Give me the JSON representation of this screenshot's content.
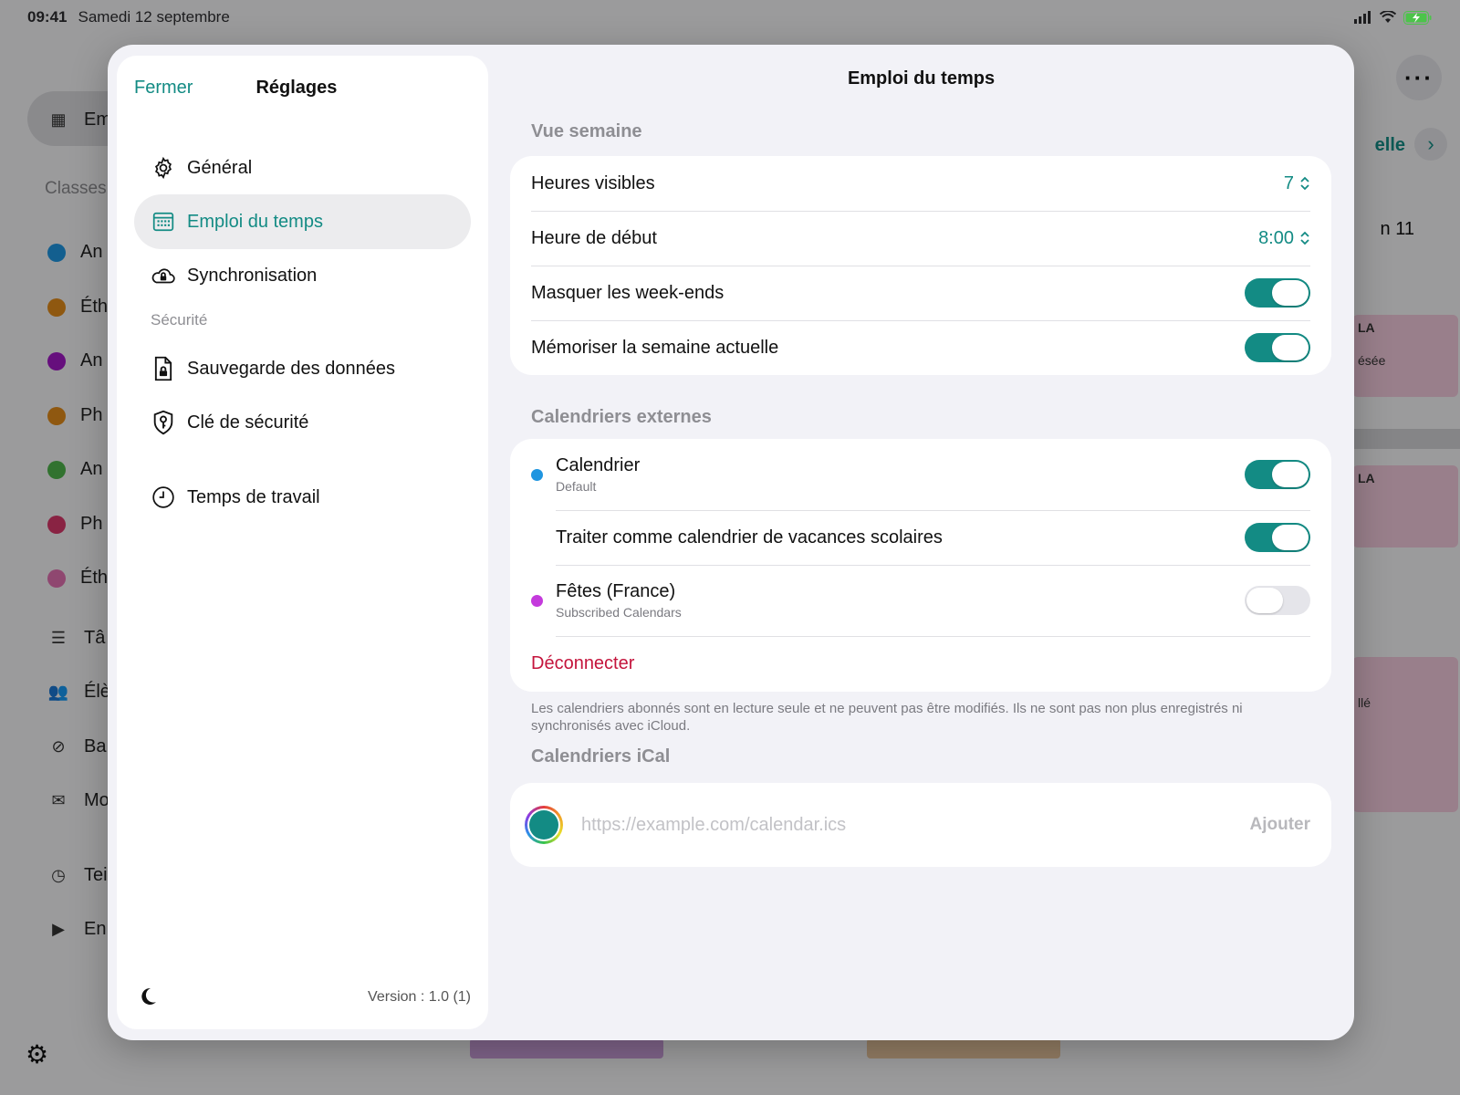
{
  "status_bar": {
    "time": "09:41",
    "date": "Samedi 12 septembre"
  },
  "background": {
    "selected_item": "Em",
    "section_label": "Classes",
    "classes": [
      {
        "label": "An",
        "color": "#1f95e0"
      },
      {
        "label": "Éth",
        "color": "#e08a1a"
      },
      {
        "label": "An",
        "color": "#a018c4"
      },
      {
        "label": "Ph",
        "color": "#e08a1a"
      },
      {
        "label": "An",
        "color": "#4db34a"
      },
      {
        "label": "Ph",
        "color": "#d6386a"
      },
      {
        "label": "Éth",
        "color": "#e070b0"
      }
    ],
    "nav": [
      "Tâ",
      "Élè",
      "Ba",
      "Mo"
    ],
    "nav2": [
      "Tei",
      "En"
    ],
    "right_link": "elle",
    "right_day": "n 11",
    "right_event_1": "LA",
    "right_event_1_sub": "ésée",
    "right_event_2": "LA",
    "right_event_3": "llé"
  },
  "settings": {
    "close_label": "Fermer",
    "title": "Réglages",
    "items": [
      {
        "label": "Général",
        "icon": "gear-icon"
      },
      {
        "label": "Emploi du temps",
        "icon": "calendar-icon"
      },
      {
        "label": "Synchronisation",
        "icon": "cloud-lock-icon"
      }
    ],
    "security_section": "Sécurité",
    "security_items": [
      {
        "label": "Sauvegarde des données",
        "icon": "document-lock-icon"
      },
      {
        "label": "Clé de sécurité",
        "icon": "shield-key-icon"
      }
    ],
    "work_item": {
      "label": "Temps de travail",
      "icon": "clock-icon"
    },
    "version": "Version : 1.0 (1)"
  },
  "main": {
    "title": "Emploi du temps",
    "week_section": "Vue semaine",
    "visible_hours_label": "Heures visibles",
    "visible_hours_value": "7",
    "start_hour_label": "Heure de début",
    "start_hour_value": "8:00",
    "hide_weekends_label": "Masquer les week-ends",
    "hide_weekends_on": true,
    "remember_week_label": "Mémoriser la semaine actuelle",
    "remember_week_on": true,
    "external_section": "Calendriers externes",
    "calendars": [
      {
        "name": "Calendrier",
        "source": "Default",
        "color": "#1f95e0",
        "on": true
      },
      {
        "name": "Fêtes (France)",
        "source": "Subscribed Calendars",
        "color": "#c43adc",
        "on": false
      }
    ],
    "school_holidays_label": "Traiter comme calendrier de vacances scolaires",
    "school_holidays_on": true,
    "disconnect_label": "Déconnecter",
    "note": "Les calendriers abonnés sont en lecture seule et ne peuvent pas être modifiés. Ils ne sont pas non plus enregistrés ni synchronisés avec iCloud.",
    "ical_section": "Calendriers iCal",
    "ical_placeholder": "https://example.com/calendar.ics",
    "ical_add_label": "Ajouter"
  },
  "colors": {
    "accent": "#138b84",
    "destructive": "#c4143c"
  }
}
